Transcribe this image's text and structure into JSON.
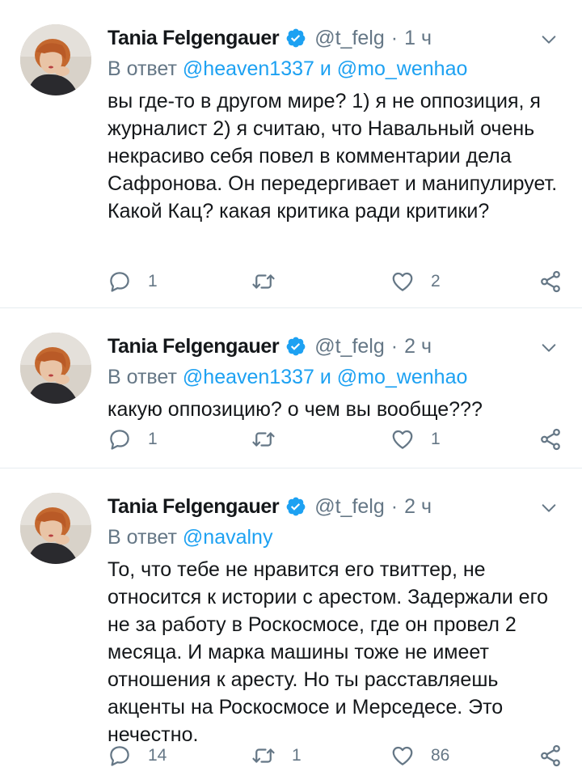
{
  "tweets": [
    {
      "author": "Tania Felgengauer",
      "handle": "@t_felg",
      "time": "1 ч",
      "reply_prefix": "В ответ",
      "reply_to_1": "@heaven1337",
      "reply_join": "и",
      "reply_to_2": "@mo_wenhao",
      "text": "вы где-то в другом мире? 1) я не оппозиция, я журналист 2) я считаю, что Навальный очень некрасиво себя повел в комментарии дела Сафронова. Он передергивает и манипулирует. Какой Кац? какая критика ради критики?",
      "replies": "1",
      "retweets": "",
      "likes": "2"
    },
    {
      "author": "Tania Felgengauer",
      "handle": "@t_felg",
      "time": "2 ч",
      "reply_prefix": "В ответ",
      "reply_to_1": "@heaven1337",
      "reply_join": "и",
      "reply_to_2": "@mo_wenhao",
      "text": "какую оппозицию? о чем вы вообще???",
      "replies": "1",
      "retweets": "",
      "likes": "1"
    },
    {
      "author": "Tania Felgengauer",
      "handle": "@t_felg",
      "time": "2 ч",
      "reply_prefix": "В ответ",
      "reply_to_1": "@navalny",
      "text": "То, что тебе не нравится его твиттер, не относится к истории с арестом. Задержали его не за работу в Роскосмосе, где он провел 2 месяца. И марка машины тоже не имеет отношения к аресту. Но ты расставляешь акценты на Роскосмосе и Мерседесе. Это нечестно.",
      "replies": "14",
      "retweets": "1",
      "likes": "86"
    }
  ],
  "colors": {
    "accent": "#1da1f2",
    "muted": "#657786",
    "text": "#14171a",
    "divider": "#e6ecf0"
  },
  "icons": [
    "verified-badge-icon",
    "chevron-down-icon",
    "reply-icon",
    "retweet-icon",
    "like-icon",
    "share-icon"
  ]
}
